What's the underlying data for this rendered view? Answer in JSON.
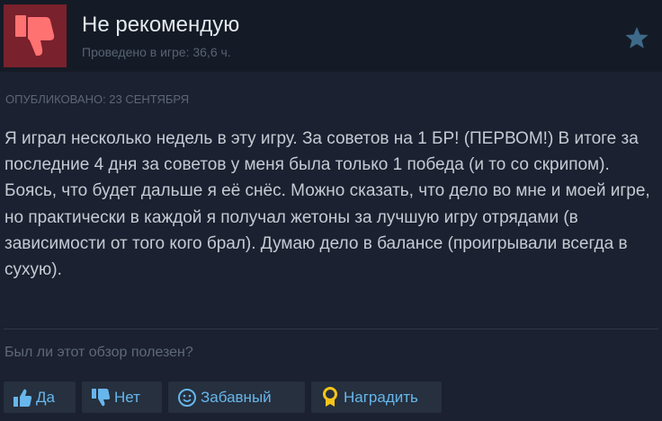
{
  "review": {
    "recommendation": "Не рекомендую",
    "hours_played": "Проведено в игре: 36,6 ч.",
    "posted": "ОПУБЛИКОВАНО: 23 СЕНТЯБРЯ",
    "text": "Я играл несколько недель в эту игру. За советов на 1 БР! (ПЕРВОМ!) В итоге за последние 4 дня за советов у меня была только 1 победа (и то со скрипом). Боясь, что будет дальше я её снёс. Можно сказать, что дело во мне и моей игре, но практически в каждой я получал жетоны за лучшую игру отрядами (в зависимости от того кого брал). Думаю дело в балансе (проигрывали всегда в сухую)."
  },
  "feedback": {
    "question": "Был ли этот обзор полезен?",
    "yes_label": "Да",
    "no_label": "Нет",
    "funny_label": "Забавный",
    "award_label": "Наградить"
  },
  "icons": {
    "review_thumb": "thumbs-down-icon",
    "award_star": "star-icon",
    "yes": "thumbs-up-icon",
    "no": "thumbs-down-icon",
    "funny": "smiley-icon",
    "award": "award-medal-icon"
  },
  "colors": {
    "background": "#1b2130",
    "header_background": "#151b26",
    "thumb_box": "#79212c",
    "thumb_icon": "#ff7272",
    "button_background": "#26303e",
    "button_text": "#67b6ec",
    "award_icon": "#f5c518"
  }
}
